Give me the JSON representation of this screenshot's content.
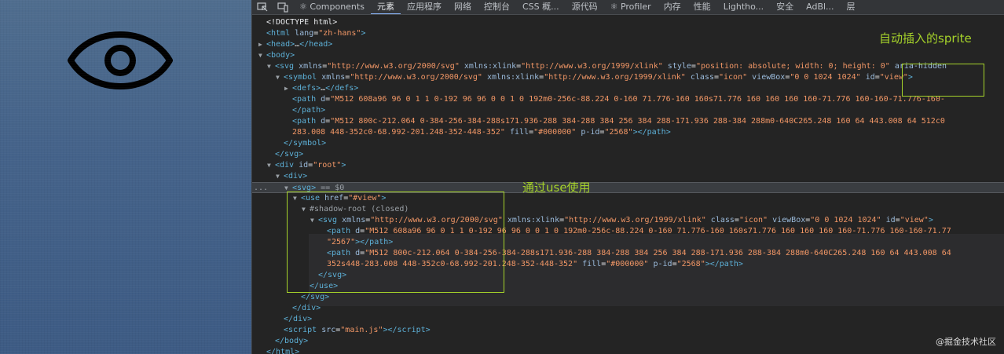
{
  "tabs": [
    {
      "label": "⚛ Components"
    },
    {
      "label": "元素"
    },
    {
      "label": "应用程序"
    },
    {
      "label": "网络"
    },
    {
      "label": "控制台"
    },
    {
      "label": "CSS 概..."
    },
    {
      "label": "源代码"
    },
    {
      "label": "⚛ Profiler"
    },
    {
      "label": "内存"
    },
    {
      "label": "性能"
    },
    {
      "label": "Lightho..."
    },
    {
      "label": "安全"
    },
    {
      "label": "AdBl..."
    },
    {
      "label": "层"
    }
  ],
  "active_tab": "元素",
  "dom_lines": [
    {
      "indent": 0,
      "arrow": "",
      "html": "<span class=\"tx\">&lt;!DOCTYPE html&gt;</span>"
    },
    {
      "indent": 0,
      "arrow": "",
      "html": "<span class=\"tag\">&lt;html</span> <span class=\"an\">lang</span>=<span class=\"av\">\"zh-hans\"</span><span class=\"tag\">&gt;</span>"
    },
    {
      "indent": 0,
      "arrow": "▶",
      "html": "<span class=\"tag\">&lt;head&gt;</span><span class=\"tx\">…</span><span class=\"tag\">&lt;/head&gt;</span>"
    },
    {
      "indent": 0,
      "arrow": "▼",
      "html": "<span class=\"tag\">&lt;body&gt;</span>"
    },
    {
      "indent": 1,
      "arrow": "▼",
      "html": "<span class=\"tag\">&lt;svg</span> <span class=\"an\">xmlns</span>=<span class=\"av\">\"http://www.w3.org/2000/svg\"</span> <span class=\"an\">xmlns:xlink</span>=<span class=\"av\">\"http://www.w3.org/1999/xlink\"</span> <span class=\"an\">style</span>=<span class=\"av\">\"position: absolute; width: 0; height: 0\"</span> <span class=\"an\">aria-hidden</span>"
    },
    {
      "indent": 2,
      "arrow": "▼",
      "html": "<span class=\"tag\">&lt;symbol</span> <span class=\"an\">xmlns</span>=<span class=\"av\">\"http://www.w3.org/2000/svg\"</span> <span class=\"an\">xmlns:xlink</span>=<span class=\"av\">\"http://www.w3.org/1999/xlink\"</span> <span class=\"an\">class</span>=<span class=\"av\">\"icon\"</span> <span class=\"an\">viewBox</span>=<span class=\"av\">\"0 0 1024 1024\"</span> <span class=\"an\">id</span>=<span class=\"av\">\"view\"</span><span class=\"tag\">&gt;</span>"
    },
    {
      "indent": 3,
      "arrow": "▶",
      "html": "<span class=\"tag\">&lt;defs&gt;</span><span class=\"tx\">…</span><span class=\"tag\">&lt;/defs&gt;</span>"
    },
    {
      "indent": 3,
      "arrow": "",
      "html": "<span class=\"tag\">&lt;path</span> <span class=\"an\">d</span>=<span class=\"av\">\"M512 608a96 96 0 1 1 0-192 96 96 0 0 1 0 192m0-256c-88.224 0-160 71.776-160 160s71.776 160 160 160 160-71.776 160-160-71.776-160-</span>"
    },
    {
      "indent": 3,
      "arrow": "",
      "html": "<span class=\"tag\">&lt;/path&gt;</span>"
    },
    {
      "indent": 3,
      "arrow": "",
      "html": "<span class=\"tag\">&lt;path</span> <span class=\"an\">d</span>=<span class=\"av\">\"M512 800c-212.064 0-384-256-384-288s171.936-288 384-288 384 256 384 288-171.936 288-384 288m0-640C265.248 160 64 443.008 64 512c0</span>"
    },
    {
      "indent": 3,
      "arrow": "",
      "html": "<span class=\"av\">283.008 448-352c0-68.992-201.248-352-448-352\"</span> <span class=\"an\">fill</span>=<span class=\"av\">\"#000000\"</span> <span class=\"an\">p-id</span>=<span class=\"av\">\"2568\"</span><span class=\"tag\">&gt;&lt;/path&gt;</span>"
    },
    {
      "indent": 2,
      "arrow": "",
      "html": "<span class=\"tag\">&lt;/symbol&gt;</span>"
    },
    {
      "indent": 1,
      "arrow": "",
      "html": "<span class=\"tag\">&lt;/svg&gt;</span>"
    },
    {
      "indent": 1,
      "arrow": "▼",
      "html": "<span class=\"tag\">&lt;div</span> <span class=\"an\">id</span>=<span class=\"av\">\"root\"</span><span class=\"tag\">&gt;</span>"
    },
    {
      "indent": 2,
      "arrow": "▼",
      "html": "<span class=\"tag\">&lt;div&gt;</span>"
    },
    {
      "indent": 3,
      "arrow": "▼",
      "html": "<span class=\"tag\">&lt;svg&gt;</span> <span class=\"gy\">== $0</span>",
      "selected": true
    },
    {
      "indent": 4,
      "arrow": "▼",
      "html": "<span class=\"tag\">&lt;use</span> <span class=\"an\">href</span>=<span class=\"av\">\"#view\"</span><span class=\"tag\">&gt;</span>"
    },
    {
      "indent": 5,
      "arrow": "▼",
      "html": "<span class=\"gy\">#shadow-root (closed)</span>"
    },
    {
      "indent": 6,
      "arrow": "▼",
      "html": "<span class=\"tag\">&lt;svg</span> <span class=\"an\">xmlns</span>=<span class=\"av\">\"http://www.w3.org/2000/svg\"</span> <span class=\"an\">xmlns:xlink</span>=<span class=\"av\">\"http://www.w3.org/1999/xlink\"</span> <span class=\"an\">class</span>=<span class=\"av\">\"icon\"</span> <span class=\"an\">viewBox</span>=<span class=\"av\">\"0 0 1024 1024\"</span> <span class=\"an\">id</span>=<span class=\"av\">\"view\"</span><span class=\"tag\">&gt;</span>"
    },
    {
      "indent": 7,
      "arrow": "",
      "html": "<span class=\"tag\">&lt;path</span> <span class=\"an\">d</span>=<span class=\"av\">\"M512 608a96 96 0 1 1 0-192 96 96 0 0 1 0 192m0-256c-88.224 0-160 71.776-160 160s71.776 160 160 160 160-71.776 160-160-71.77</span>"
    },
    {
      "indent": 7,
      "arrow": "",
      "html": "<span class=\"av\">\"2567\"</span><span class=\"tag\">&gt;&lt;/path&gt;</span>"
    },
    {
      "indent": 7,
      "arrow": "",
      "html": "<span class=\"tag\">&lt;path</span> <span class=\"an\">d</span>=<span class=\"av\">\"M512 800c-212.064 0-384-256-384-288s171.936-288 384-288 384 256 384 288-171.936 288-384 288m0-640C265.248 160 64 443.008 64</span>"
    },
    {
      "indent": 7,
      "arrow": "",
      "html": "<span class=\"av\">352s448-283.008 448-352c0-68.992-201.248-352-448-352\"</span> <span class=\"an\">fill</span>=<span class=\"av\">\"#000000\"</span> <span class=\"an\">p-id</span>=<span class=\"av\">\"2568\"</span><span class=\"tag\">&gt;&lt;/path&gt;</span>"
    },
    {
      "indent": 6,
      "arrow": "",
      "html": "<span class=\"tag\">&lt;/svg&gt;</span>"
    },
    {
      "indent": 5,
      "arrow": "",
      "html": "<span class=\"tag\">&lt;/use&gt;</span>"
    },
    {
      "indent": 4,
      "arrow": "",
      "html": "<span class=\"tag\">&lt;/svg&gt;</span>"
    },
    {
      "indent": 3,
      "arrow": "",
      "html": "<span class=\"tag\">&lt;/div&gt;</span>"
    },
    {
      "indent": 2,
      "arrow": "",
      "html": "<span class=\"tag\">&lt;/div&gt;</span>"
    },
    {
      "indent": 2,
      "arrow": "",
      "html": "<span class=\"tag\">&lt;script</span> <span class=\"an\">src</span>=<span class=\"av\">\"main.js\"</span><span class=\"tag\">&gt;&lt;/script&gt;</span>"
    },
    {
      "indent": 1,
      "arrow": "",
      "html": "<span class=\"tag\">&lt;/body&gt;</span>"
    },
    {
      "indent": 0,
      "arrow": "",
      "html": "<span class=\"tag\">&lt;/html&gt;</span>"
    }
  ],
  "ellipsis": "...",
  "annotations": {
    "sprite_label": "自动插入的sprite",
    "use_label": "通过use使用"
  },
  "watermark": "@掘金技术社区",
  "colors": {
    "annotation": "#a6d32a",
    "tag": "#5db0d7",
    "attr_name": "#9bbbdc",
    "attr_value": "#f29766"
  }
}
